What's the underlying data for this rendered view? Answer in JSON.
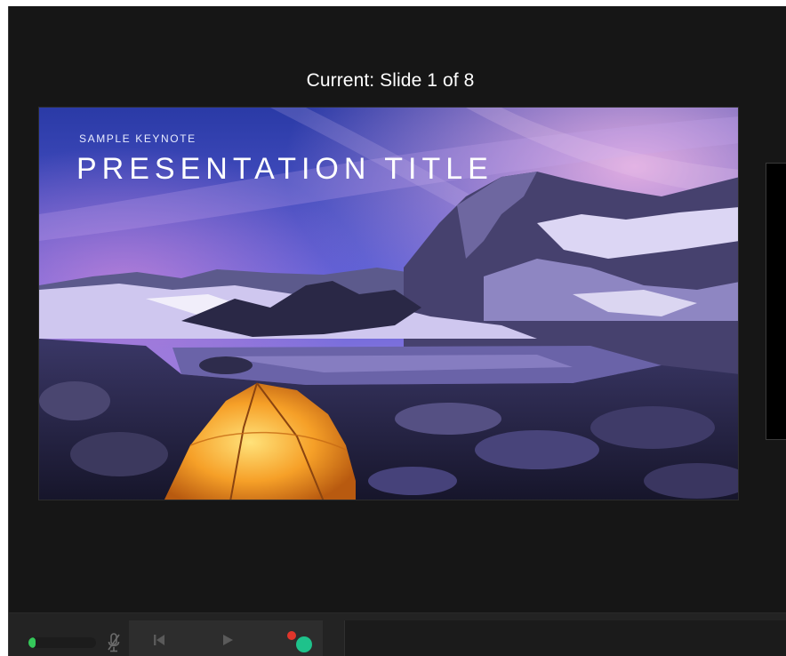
{
  "window": {
    "slide_indicator": "Current: Slide 1 of 8"
  },
  "current_slide": {
    "kicker": "SAMPLE KEYNOTE",
    "title": "PRESENTATION TITLE"
  },
  "controls": {
    "mic_level": 0.06,
    "icons": [
      "microphone-muted-icon",
      "previous-icon",
      "play-icon",
      "record-icon"
    ]
  },
  "colors": {
    "window_bg": "#161616",
    "bar_bg": "#232323",
    "record_red": "#e0352b",
    "active_green": "#1ec28b",
    "level_green": "#35c85a"
  }
}
